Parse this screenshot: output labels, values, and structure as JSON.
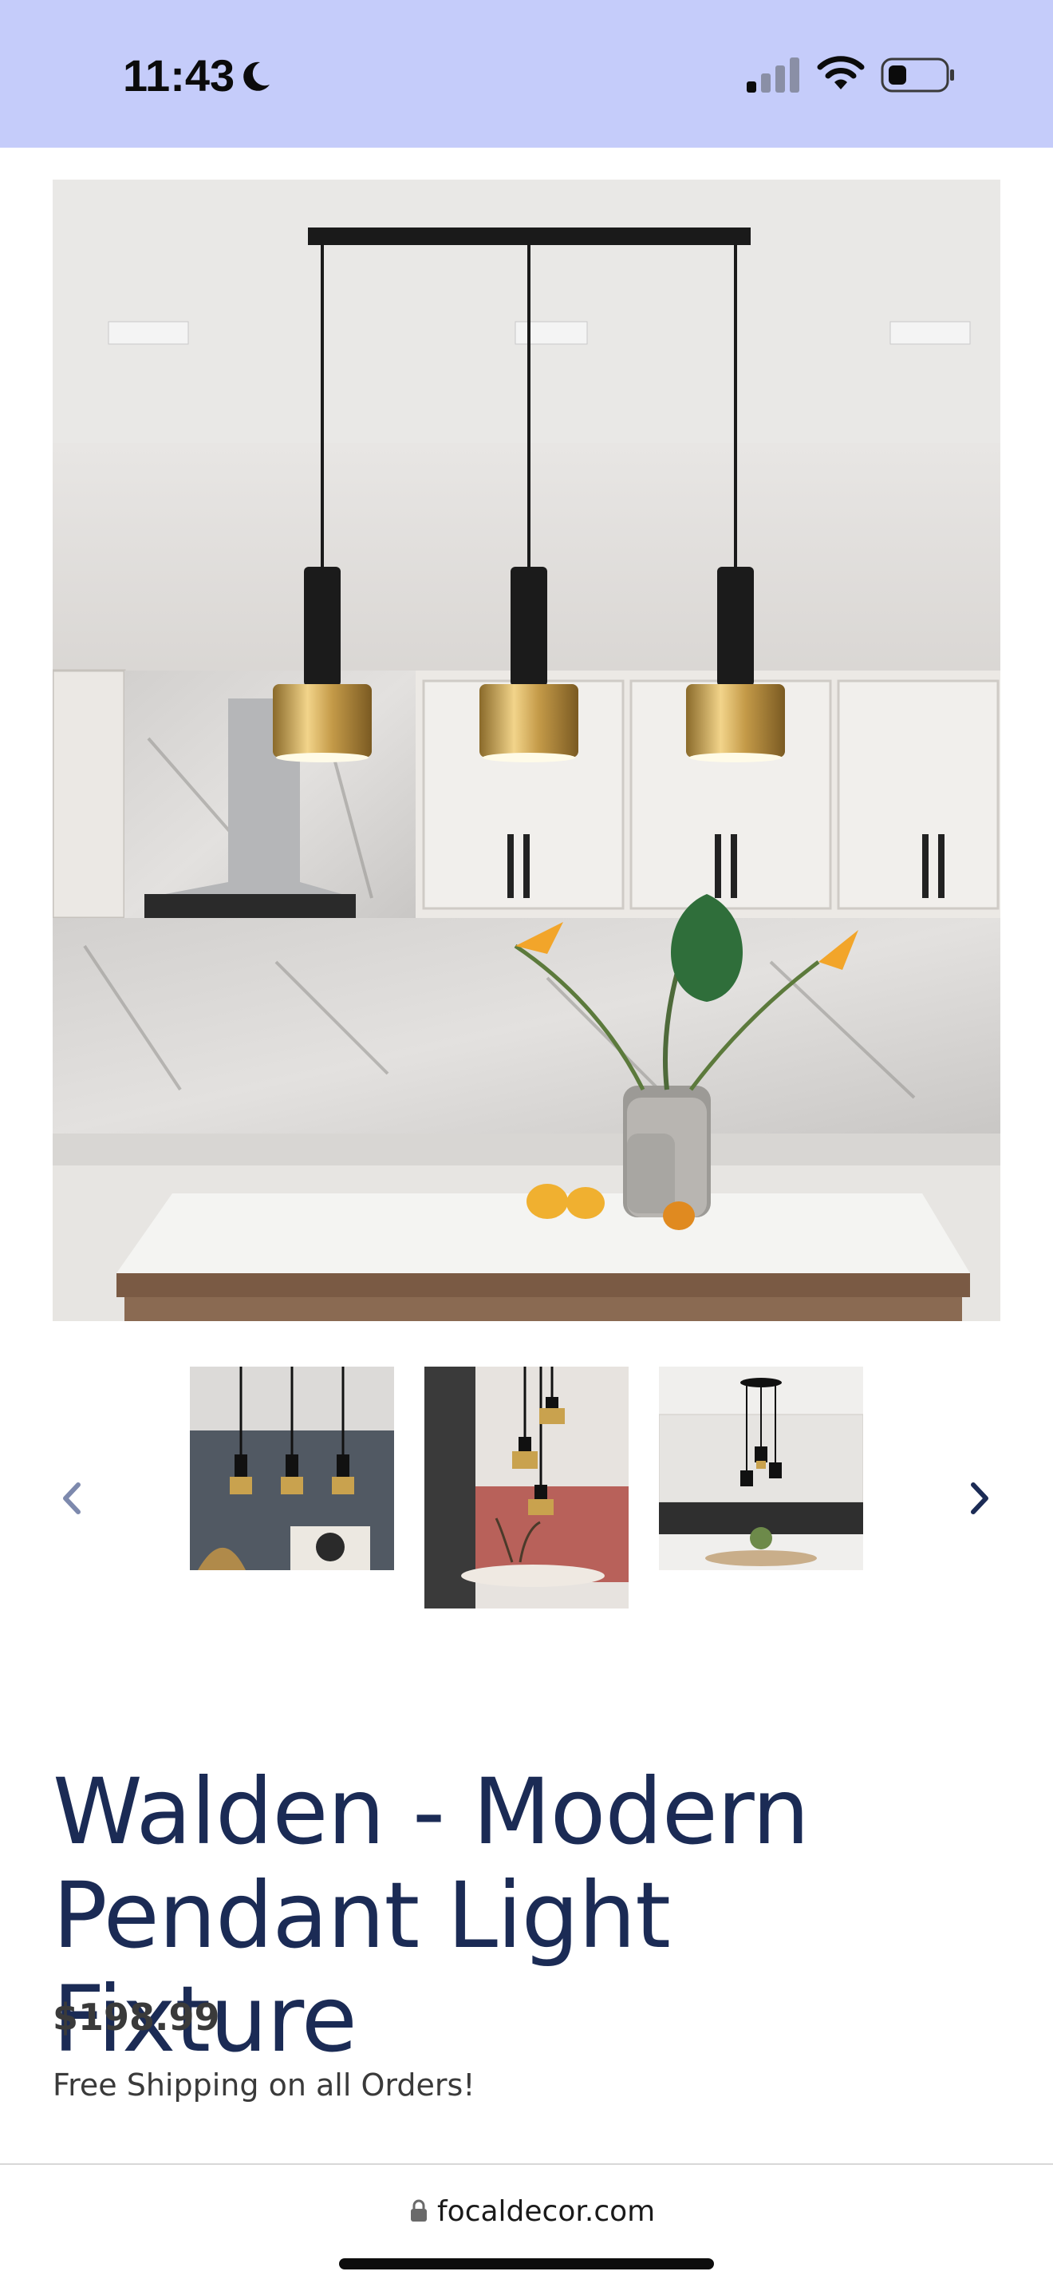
{
  "status_bar": {
    "time": "11:43",
    "icons": [
      "moon-icon",
      "signal-icon",
      "wifi-icon",
      "battery-icon"
    ],
    "background_color": "#c5ccfa"
  },
  "product": {
    "hero_image": "kitchen-pendant-lights-image",
    "thumbnails": [
      {
        "name": "thumbnail-gray-wall-pendants"
      },
      {
        "name": "thumbnail-dining-room-pendants",
        "selected": true
      },
      {
        "name": "thumbnail-white-kitchen-cluster"
      }
    ],
    "prev_icon": "chevron-left-icon",
    "next_icon": "chevron-right-icon",
    "title": "Walden - Modern Pendant Light Fixture",
    "price": "$198.99",
    "shipping_note": "Free Shipping on all Orders!"
  },
  "browser": {
    "url": "focaldecor.com",
    "lock_icon": "lock-icon"
  },
  "colors": {
    "title": "#1b2b55",
    "text": "#3a3a3a"
  }
}
